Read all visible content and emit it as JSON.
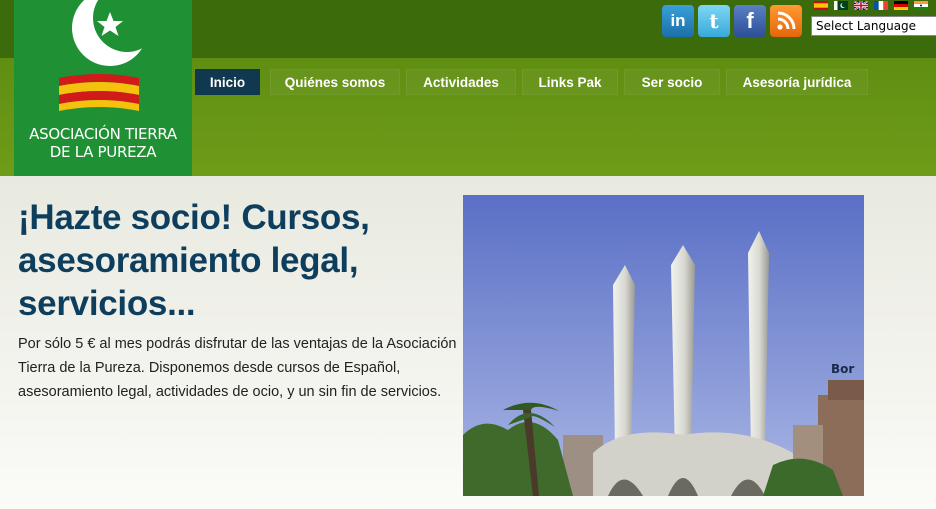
{
  "logo": {
    "line1": "ASOCIACIÓN TIERRA",
    "line2": "DE LA PUREZA"
  },
  "social": {
    "linkedin": "in",
    "twitter": "t",
    "facebook": "f",
    "rss": "rss-icon"
  },
  "language": {
    "selected": "Select Language",
    "flags": [
      "Spanish",
      "Urdu",
      "English",
      "French",
      "German",
      "Hindi"
    ]
  },
  "nav": [
    {
      "label": "Inicio",
      "active": true
    },
    {
      "label": "Quiénes somos"
    },
    {
      "label": "Actividades"
    },
    {
      "label": "Links Pak"
    },
    {
      "label": "Ser socio"
    },
    {
      "label": "Asesoría jurídica"
    }
  ],
  "main": {
    "headline_1": "¡Hazte socio! Cursos,",
    "headline_2": "asesoramiento legal,",
    "headline_3": "servicios...",
    "body": "Por sólo 5 € al mes podrás disfrutar de las ventajas de la Asociación Tierra de la Pureza. Disponemos desde cursos de Español, asesoramiento legal, actividades de ocio, y un sin fin de servicios."
  },
  "photo_sign": "Bor",
  "colors": {
    "header_dark": "#3b6b0a",
    "nav_green": "#6f9c18",
    "logo_green": "#1f9134",
    "active_tab": "#10384e",
    "headline": "#0e3e5e"
  }
}
